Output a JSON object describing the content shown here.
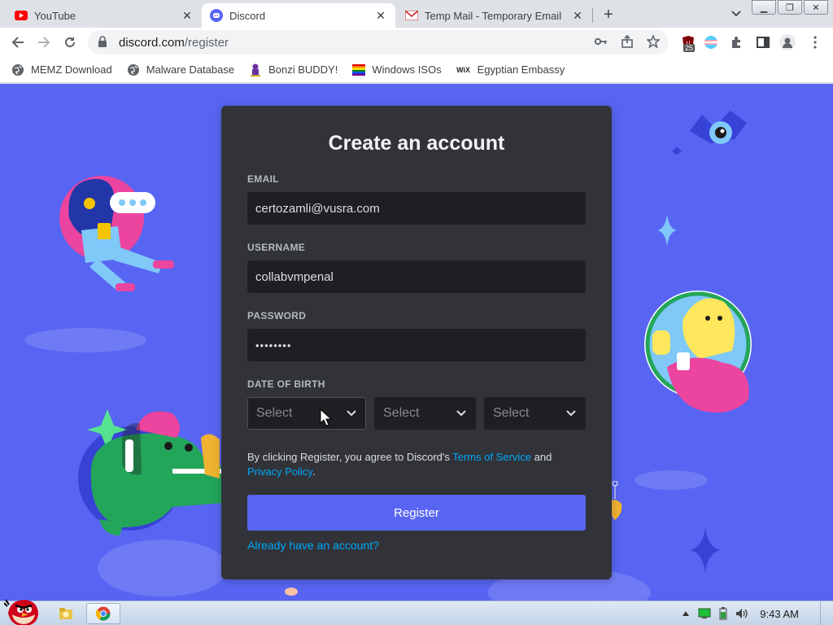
{
  "browser": {
    "tabs": [
      {
        "title": "YouTube",
        "favicon": "youtube-icon",
        "active": false
      },
      {
        "title": "Discord",
        "favicon": "discord-icon",
        "active": true
      },
      {
        "title": "Temp Mail - Temporary Email",
        "favicon": "gmail-icon",
        "active": false
      }
    ],
    "url_host": "discord.com",
    "url_path": "/register",
    "extension_badge": "25",
    "bookmarks": [
      {
        "label": "MEMZ Download",
        "icon": "globe-icon"
      },
      {
        "label": "Malware Database",
        "icon": "globe-icon"
      },
      {
        "label": "Bonzi BUDDY!",
        "icon": "bonzi-icon"
      },
      {
        "label": "Windows ISOs",
        "icon": "rainbow-flag-icon"
      },
      {
        "label": "Egyptian Embassy",
        "icon": "wix-icon"
      }
    ],
    "wix_glyph": "WiX"
  },
  "form": {
    "title": "Create an account",
    "email_label": "EMAIL",
    "email_value": "certozamli@vusra.com",
    "username_label": "USERNAME",
    "username_value": "collabvmpenal",
    "password_label": "PASSWORD",
    "password_value": "••••••••",
    "dob_label": "DATE OF BIRTH",
    "dob_month": "Select",
    "dob_day": "Select",
    "dob_year": "Select",
    "terms_prefix": "By clicking Register, you agree to Discord's ",
    "terms_link": "Terms of Service",
    "terms_and": " and ",
    "privacy_link": "Privacy Policy",
    "terms_suffix": ".",
    "register_label": "Register",
    "login_link": "Already have an account?"
  },
  "taskbar": {
    "clock": "9:43 AM"
  },
  "colors": {
    "background": "#5865f2",
    "card": "#313338",
    "input": "#1e1f22",
    "button": "#5865f2",
    "link": "#00a8fc"
  }
}
